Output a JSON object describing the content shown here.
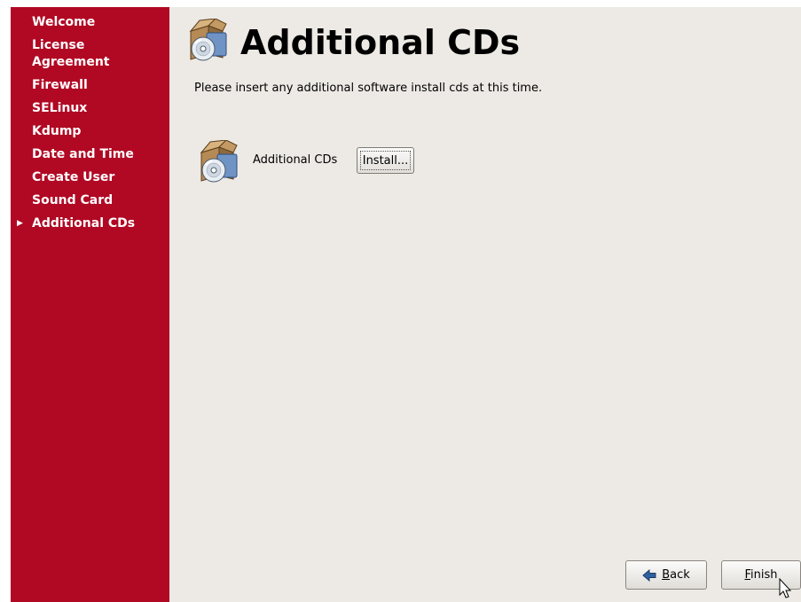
{
  "sidebar": {
    "steps": [
      {
        "label": "Welcome"
      },
      {
        "label": "License\nAgreement"
      },
      {
        "label": "Firewall"
      },
      {
        "label": "SELinux"
      },
      {
        "label": "Kdump"
      },
      {
        "label": "Date and Time"
      },
      {
        "label": "Create User"
      },
      {
        "label": "Sound Card"
      },
      {
        "label": "Additional CDs",
        "current": true
      }
    ],
    "background_color": "#b10823"
  },
  "page": {
    "title": "Additional CDs",
    "instructions": "Please insert any additional software install cds at this time.",
    "header_icon": "cd-package-icon"
  },
  "cd_row": {
    "icon": "cd-package-icon",
    "label": "Additional CDs",
    "button_label": "Install..."
  },
  "footer": {
    "back": {
      "mnemonic": "B",
      "rest": "ack",
      "icon": "back-arrow-icon"
    },
    "finish": {
      "mnemonic": "F",
      "rest": "inish"
    }
  }
}
